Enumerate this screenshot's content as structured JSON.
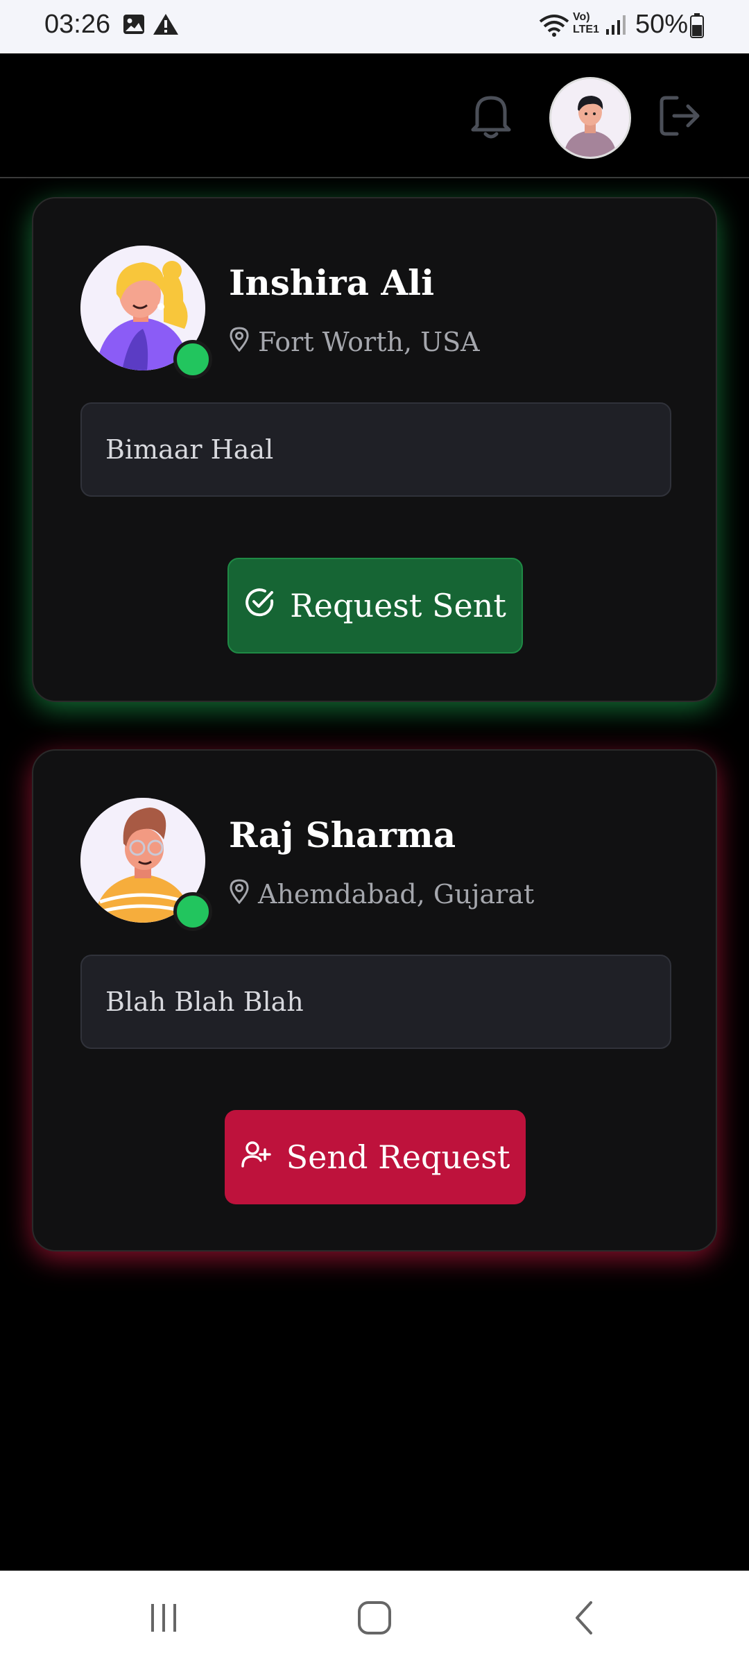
{
  "status_bar": {
    "time": "03:26",
    "battery": "50%",
    "icons": [
      "gallery-icon",
      "warning-icon",
      "wifi-icon",
      "volte-icon",
      "signal-icon",
      "battery-icon"
    ],
    "network_label": "Vo) LTE1"
  },
  "header": {
    "icons": [
      "bell-icon",
      "profile-avatar",
      "logout-icon"
    ]
  },
  "cards": [
    {
      "name": "Inshira Ali",
      "location": "Fort Worth, USA",
      "message": "Bimaar Haal",
      "button_label": "Request Sent",
      "button_icon": "check-circle-icon",
      "glow_color": "#22c55e",
      "online": true
    },
    {
      "name": "Raj Sharma",
      "location": "Ahemdabad, Gujarat",
      "message": "Blah Blah Blah",
      "button_label": "Send Request",
      "button_icon": "user-plus-icon",
      "glow_color": "#e11d48",
      "online": true
    }
  ],
  "colors": {
    "request_sent": "#166534",
    "send_request": "#be123c",
    "online": "#22c55e"
  },
  "nav_bar": {
    "buttons": [
      "recent-apps-button",
      "home-button",
      "back-button"
    ]
  }
}
